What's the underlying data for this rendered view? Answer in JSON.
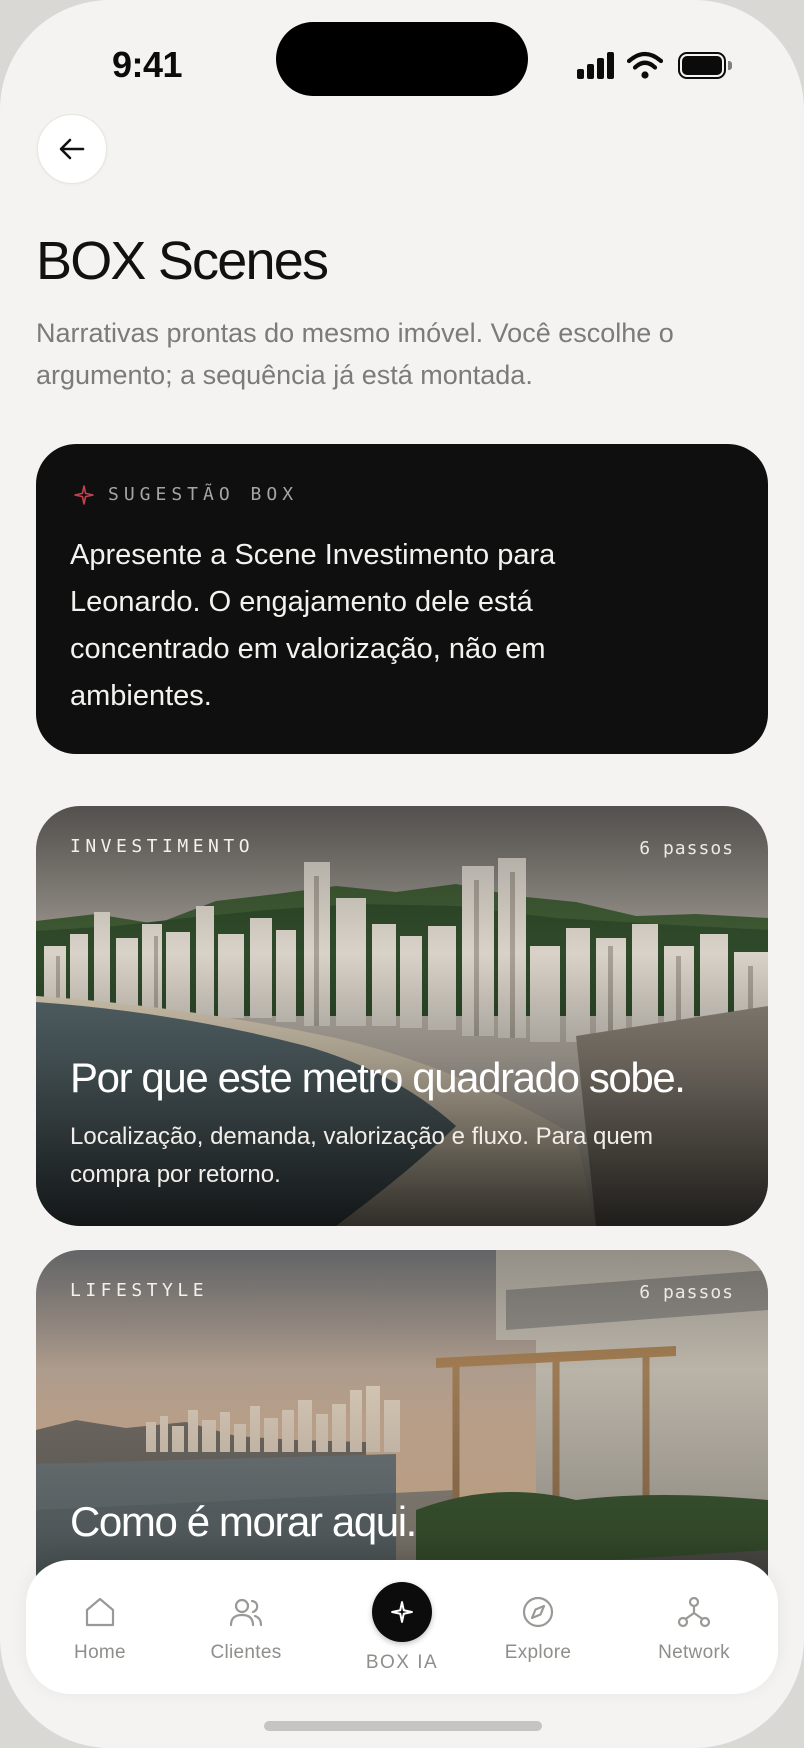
{
  "status_bar": {
    "time": "9:41"
  },
  "header": {
    "back_icon": "arrow-left-icon",
    "title": "BOX Scenes",
    "subtitle": "Narrativas prontas do mesmo imóvel. Você escolhe o argumento; a sequência já está montada."
  },
  "suggestion": {
    "icon": "sparkle-icon",
    "label": "SUGESTÃO BOX",
    "text": "Apresente a Scene Investimento para Leonardo. O engajamento dele está concentrado em valorização, não em ambientes.",
    "accent_color": "#c2424e"
  },
  "scenes": [
    {
      "tag": "INVESTIMENTO",
      "steps": "6 passos",
      "title": "Por que este metro quadrado sobe.",
      "description": "Localização, demanda, valorização e fluxo. Para quem compra por retorno."
    },
    {
      "tag": "LIFESTYLE",
      "steps": "6 passos",
      "title": "Como é morar aqui."
    }
  ],
  "tabbar": {
    "items": [
      {
        "label": "Home",
        "icon": "home-icon"
      },
      {
        "label": "Clientes",
        "icon": "users-icon"
      },
      {
        "label": "BOX IA",
        "icon": "sparkle-icon"
      },
      {
        "label": "Explore",
        "icon": "compass-icon"
      },
      {
        "label": "Network",
        "icon": "network-icon"
      }
    ]
  }
}
